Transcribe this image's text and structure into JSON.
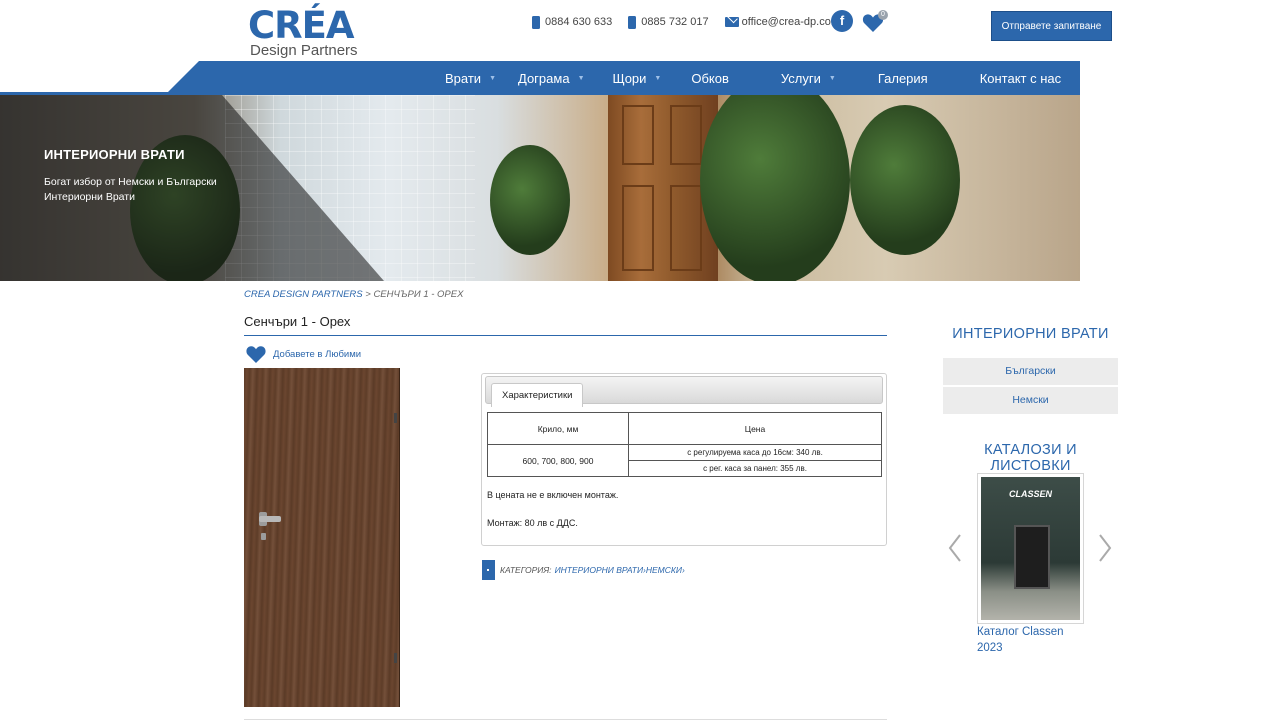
{
  "header": {
    "logo_main": "CRÉA",
    "logo_sub": "Design Partners",
    "phone1": "0884 630 633",
    "phone2": "0885 732 017",
    "email": "office@crea-dp.com",
    "facebook_label": "f",
    "favorites_count": "0",
    "cta_label": "Отправете запитване"
  },
  "nav": {
    "items": [
      {
        "label": "Врати",
        "has_dropdown": true
      },
      {
        "label": "Дограма",
        "has_dropdown": true
      },
      {
        "label": "Щори",
        "has_dropdown": true
      },
      {
        "label": "Обков",
        "has_dropdown": false
      },
      {
        "label": "Услуги",
        "has_dropdown": true
      },
      {
        "label": "Галерия",
        "has_dropdown": false
      },
      {
        "label": "Контакт с нас",
        "has_dropdown": false
      }
    ]
  },
  "hero": {
    "title": "ИНТЕРИОРНИ ВРАТИ",
    "text": "Богат избор от Немски и Български Интериорни Врати"
  },
  "breadcrumb": {
    "home": "CREA DESIGN PARTNERS",
    "separator": " > ",
    "current": "СЕНЧЪРИ 1 - ОРЕХ"
  },
  "product": {
    "title": "Сенчъри 1 - Орех",
    "add_favorite": "Добавете в Любими",
    "tab_label": "Характеристики",
    "table": {
      "headers": [
        "Крило, мм",
        "Цена"
      ],
      "sizes": "600, 700, 800, 900",
      "price1": "с регулируема каса до 16см: 340 лв.",
      "price2": "с рег. каса за панел: 355 лв."
    },
    "note_install": "В цената не е включен монтаж.",
    "note_mount": "Монтаж: 80 лв с ДДС.",
    "category_label": "КАТЕГОРИЯ:",
    "category_links": "ИНТЕРИОРНИ ВРАТИ›НЕМСКИ›"
  },
  "sidebar": {
    "heading1": "ИНТЕРИОРНИ ВРАТИ",
    "items": [
      "Български",
      "Немски"
    ],
    "heading2": "КАТАЛОЗИ И ЛИСТОВКИ",
    "catalog_brand": "CLASSEN",
    "catalog_caption": "Каталог Classen 2023"
  },
  "colors": {
    "brand": "#2c67ac",
    "sidebar_item_bg": "#ececec"
  }
}
